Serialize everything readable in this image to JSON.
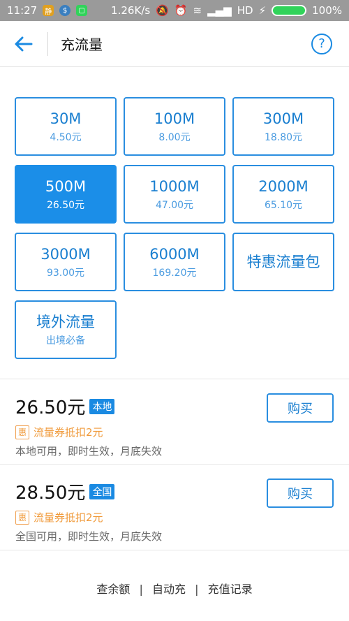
{
  "statusbar": {
    "time": "11:27",
    "speed": "1.26K/s",
    "network": "HD",
    "battery": "100%"
  },
  "header": {
    "title": "充流量"
  },
  "tiles": [
    {
      "main": "30M",
      "sub": "4.50元",
      "selected": false
    },
    {
      "main": "100M",
      "sub": "8.00元",
      "selected": false
    },
    {
      "main": "300M",
      "sub": "18.80元",
      "selected": false
    },
    {
      "main": "500M",
      "sub": "26.50元",
      "selected": true
    },
    {
      "main": "1000M",
      "sub": "47.00元",
      "selected": false
    },
    {
      "main": "2000M",
      "sub": "65.10元",
      "selected": false
    },
    {
      "main": "3000M",
      "sub": "93.00元",
      "selected": false
    },
    {
      "main": "6000M",
      "sub": "169.20元",
      "selected": false
    },
    {
      "main": "特惠流量包",
      "sub": "",
      "selected": false
    },
    {
      "main": "境外流量",
      "sub": "出境必备",
      "selected": false
    }
  ],
  "plans": [
    {
      "price": "26.50元",
      "tag": "本地",
      "coupon_icon": "惠",
      "coupon": "流量券抵扣2元",
      "desc": "本地可用，即时生效，月底失效",
      "buy_label": "购买"
    },
    {
      "price": "28.50元",
      "tag": "全国",
      "coupon_icon": "惠",
      "coupon": "流量券抵扣2元",
      "desc": "全国可用，即时生效，月底失效",
      "buy_label": "购买"
    }
  ],
  "footer": {
    "links": [
      "查余额",
      "自动充",
      "充值记录"
    ],
    "separator": "|"
  },
  "colors": {
    "accent": "#1a8ae2",
    "selected_bg": "#1b8ee8",
    "coupon": "#f09a3a",
    "statusbar": "#9a9a9a"
  }
}
